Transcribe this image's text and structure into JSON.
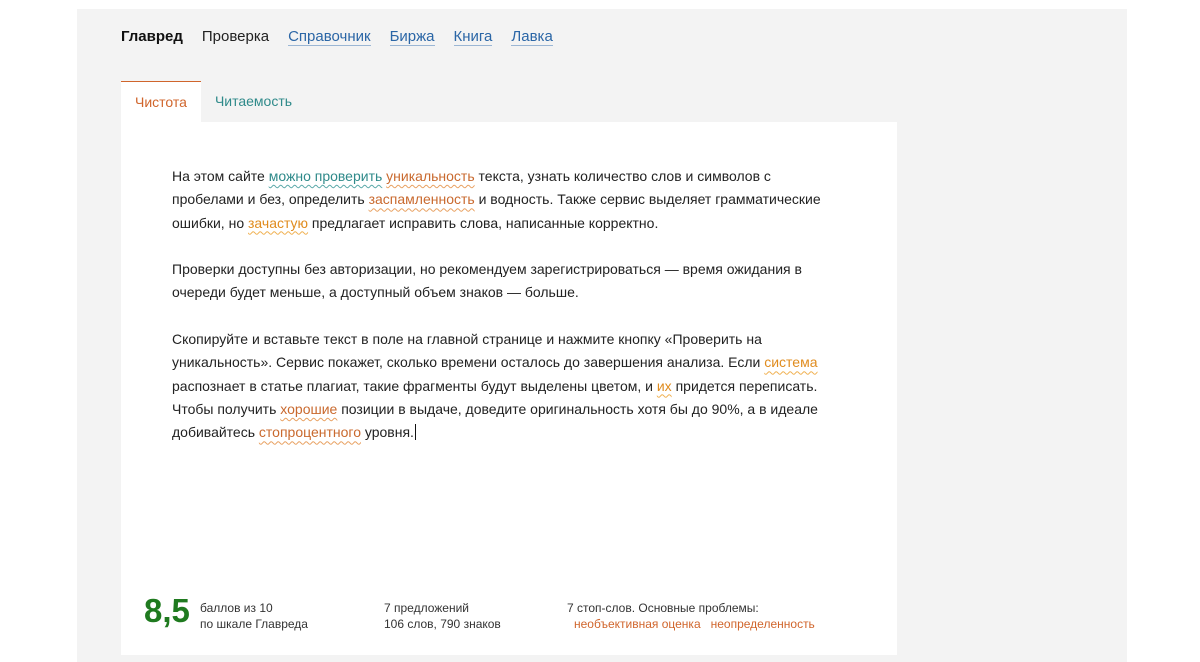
{
  "nav": {
    "items": [
      {
        "label": "Главред"
      },
      {
        "label": "Проверка"
      },
      {
        "label": "Справочник"
      },
      {
        "label": "Биржа"
      },
      {
        "label": "Книга"
      },
      {
        "label": "Лавка"
      }
    ]
  },
  "tabs": [
    {
      "label": "Чистота",
      "active": true
    },
    {
      "label": "Читаемость",
      "active": false
    }
  ],
  "text": {
    "p1": {
      "a": "На этом сайте ",
      "h1": "можно проверить",
      "b": " ",
      "h2": "уникальность",
      "c": " текста, узнать количество слов и символов с пробелами и без, определить ",
      "h3": "заспамленность",
      "d": " и водность. Также сервис выделяет грамматические ошибки, но ",
      "h4": "зачастую",
      "e": " предлагает исправить слова, написанные корректно."
    },
    "p2": {
      "a": "Проверки доступны без авторизации, но рекомендуем зарегистрироваться — время ожидания в очереди будет меньше, а доступный объем знаков — больше."
    },
    "p3": {
      "a": "Скопируйте и вставьте текст в поле на главной странице и нажмите кнопку «Проверить на уникальность». Сервис покажет, сколько времени осталось до завершения анализа. Если ",
      "h1": "система",
      "b": " распознает в статье плагиат, такие фрагменты будут выделены цветом, и ",
      "h2": "их",
      "c": " придется переписать. Чтобы получить ",
      "h3": "хорошие",
      "d": " позиции в выдаче, доведите оригинальность хотя бы до 90%, а в идеале добивайтесь ",
      "h4": "стопроцентного",
      "e": " уровня."
    }
  },
  "stats": {
    "score": "8,5",
    "score_line1": "баллов из 10",
    "score_line2": "по шкале Главреда",
    "sentences": "7 предложений",
    "words_chars": "106 слов, 790 знаков",
    "stopwords": "7 стоп-слов. Основные проблемы:",
    "problems": [
      "необъективная оценка",
      "неопределенность"
    ]
  },
  "colors": {
    "score": "#1f7a1f",
    "accent_orange": "#d0652c",
    "accent_teal": "#2f8a8a",
    "link_blue": "#2b66a6"
  }
}
